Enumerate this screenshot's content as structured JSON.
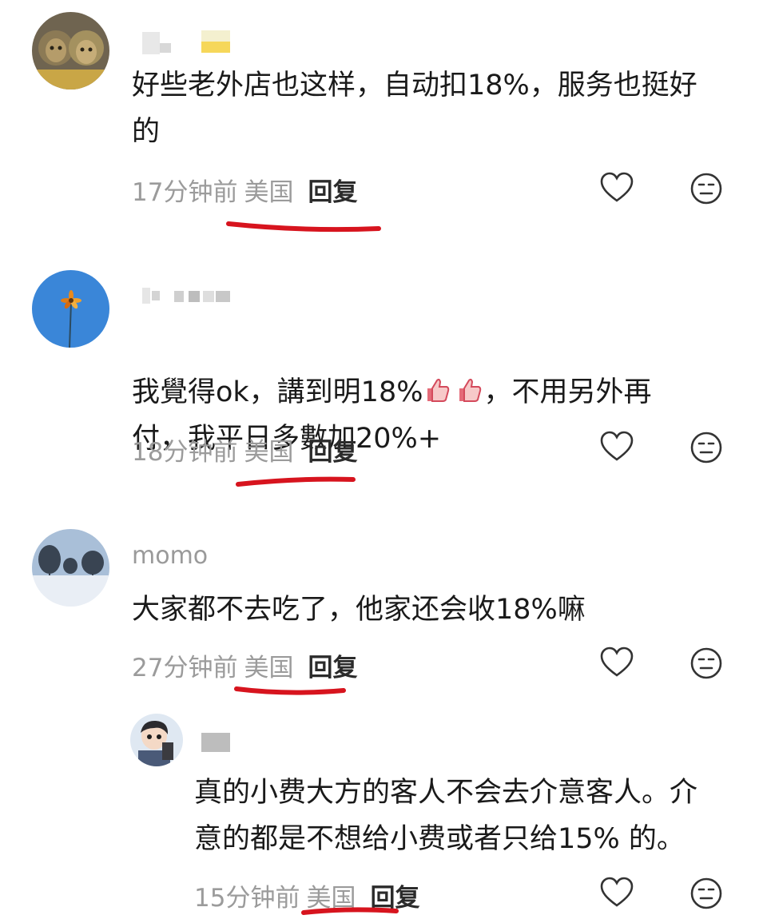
{
  "comments": [
    {
      "username": "",
      "text": "好些老外店也这样，自动扣18%，服务也挺好\n的",
      "time": "17分钟前",
      "region": "美国",
      "reply_label": "回复"
    },
    {
      "username": "",
      "text_before": "我覺得ok，講到明18%",
      "text_after": "，不用另外再",
      "text_line2": "付，我平日多數加20%+",
      "emoji": [
        "thumbs-up-icon",
        "thumbs-up-icon"
      ],
      "time": "18分钟前",
      "region": "美国",
      "reply_label": "回复"
    },
    {
      "username": "momo",
      "text": "大家都不去吃了，他家还会收18%嘛",
      "time": "27分钟前",
      "region": "美国",
      "reply_label": "回复"
    },
    {
      "username": "",
      "text": "真的小费大方的客人不会去介意客人。介\n意的都是不想给小费或者只给15% 的。",
      "time": "15分钟前",
      "region": "美国",
      "reply_label": "回复"
    }
  ],
  "colors": {
    "underline": "#d7141e",
    "meta": "#9b9b9b",
    "text": "#1a1a1a"
  }
}
